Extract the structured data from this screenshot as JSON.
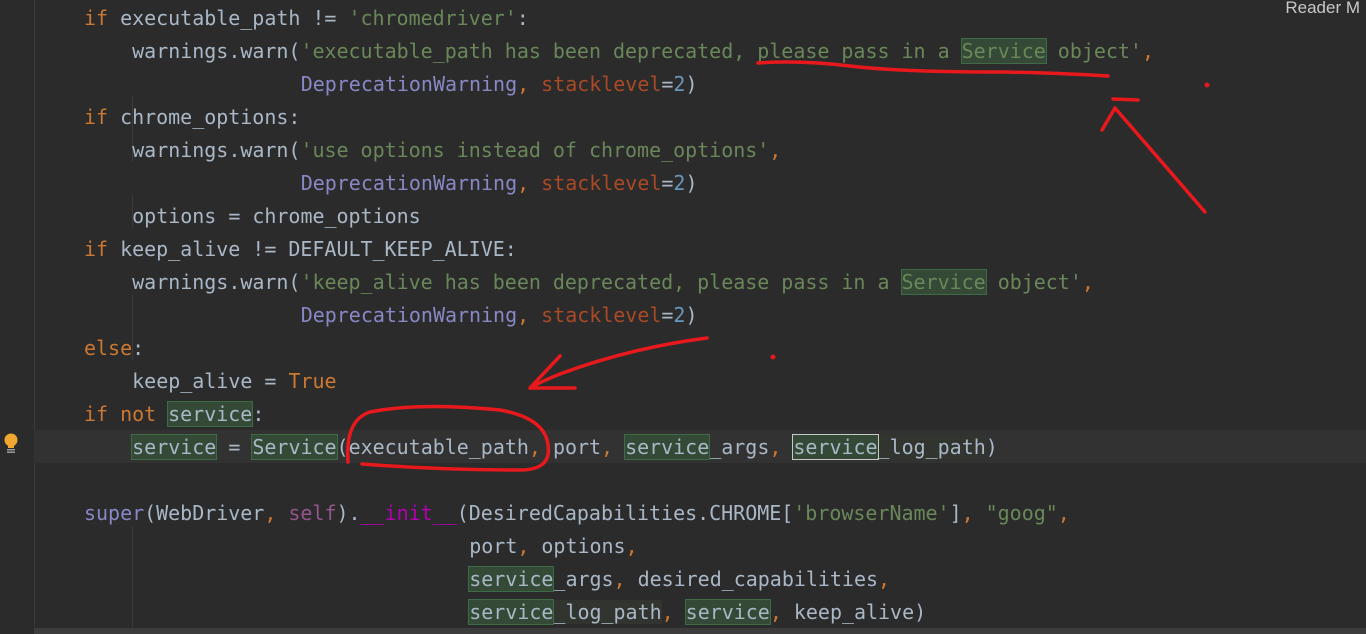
{
  "header": {
    "reader_mode_label": "Reader M"
  },
  "colors": {
    "background": "#2b2b2b",
    "keyword": "#cc7832",
    "string": "#6a8759",
    "builtin": "#8888c6",
    "param": "#aa4926",
    "number": "#6897bb",
    "annotation": "#e8191c"
  },
  "gutter": {
    "intention_icon": "lightbulb-icon"
  },
  "code": {
    "lines": [
      {
        "indent": 0,
        "tokens": [
          [
            "if",
            "kw"
          ],
          [
            " executable_path != ",
            ""
          ],
          [
            "'chromedriver'",
            "str"
          ],
          [
            ":",
            ""
          ]
        ]
      },
      {
        "indent": 4,
        "tokens": [
          [
            "warnings.warn(",
            ""
          ],
          [
            "'executable_path has been deprecated, please pass in a ",
            "str"
          ],
          [
            "Service",
            "str hl"
          ],
          [
            " object'",
            "str"
          ],
          [
            ",",
            "punc"
          ]
        ]
      },
      {
        "indent": 18,
        "tokens": [
          [
            "DeprecationWarning",
            "bi"
          ],
          [
            ", ",
            "punc"
          ],
          [
            "stacklevel",
            "param"
          ],
          [
            "=",
            ""
          ],
          [
            "2",
            "num"
          ],
          [
            ")",
            ""
          ]
        ]
      },
      {
        "indent": 0,
        "tokens": [
          [
            "if",
            "kw"
          ],
          [
            " chrome_options:",
            ""
          ]
        ]
      },
      {
        "indent": 4,
        "tokens": [
          [
            "warnings.warn(",
            ""
          ],
          [
            "'use options instead of chrome_options'",
            "str"
          ],
          [
            ",",
            "punc"
          ]
        ]
      },
      {
        "indent": 18,
        "tokens": [
          [
            "DeprecationWarning",
            "bi"
          ],
          [
            ", ",
            "punc"
          ],
          [
            "stacklevel",
            "param"
          ],
          [
            "=",
            ""
          ],
          [
            "2",
            "num"
          ],
          [
            ")",
            ""
          ]
        ]
      },
      {
        "indent": 4,
        "tokens": [
          [
            "options = chrome_options",
            ""
          ]
        ]
      },
      {
        "indent": 0,
        "tokens": [
          [
            "if",
            "kw"
          ],
          [
            " keep_alive != DEFAULT_KEEP_ALIVE:",
            ""
          ]
        ]
      },
      {
        "indent": 4,
        "tokens": [
          [
            "warnings.warn(",
            ""
          ],
          [
            "'keep_alive has been deprecated, please pass in a ",
            "str"
          ],
          [
            "Service",
            "str hl"
          ],
          [
            " object'",
            "str"
          ],
          [
            ",",
            "punc"
          ]
        ]
      },
      {
        "indent": 18,
        "tokens": [
          [
            "DeprecationWarning",
            "bi"
          ],
          [
            ", ",
            "punc"
          ],
          [
            "stacklevel",
            "param"
          ],
          [
            "=",
            ""
          ],
          [
            "2",
            "num"
          ],
          [
            ")",
            ""
          ]
        ]
      },
      {
        "indent": 0,
        "tokens": [
          [
            "else",
            "kw"
          ],
          [
            ":",
            ""
          ]
        ]
      },
      {
        "indent": 4,
        "tokens": [
          [
            "keep_alive = ",
            ""
          ],
          [
            "True",
            "kw"
          ]
        ]
      },
      {
        "indent": 0,
        "tokens": [
          [
            "if not ",
            "kw"
          ],
          [
            "service",
            "hl"
          ],
          [
            ":",
            ""
          ]
        ]
      },
      {
        "indent": 4,
        "tokens": [
          [
            "service",
            "hl"
          ],
          [
            " = ",
            ""
          ],
          [
            "Service",
            "hl"
          ],
          [
            "(executable_path",
            ""
          ],
          [
            ", ",
            "punc"
          ],
          [
            "port",
            ""
          ],
          [
            ", ",
            "punc"
          ],
          [
            "service",
            "hl"
          ],
          [
            "_args",
            ""
          ],
          [
            ", ",
            "punc"
          ],
          [
            "service",
            "hlbox"
          ],
          [
            "_log_path",
            "hl2"
          ],
          [
            ")",
            ""
          ]
        ]
      },
      {
        "indent": 0,
        "tokens": []
      },
      {
        "indent": 0,
        "tokens": [
          [
            "super",
            "bi"
          ],
          [
            "(WebDriver",
            ""
          ],
          [
            ", ",
            "punc"
          ],
          [
            "self",
            "self"
          ],
          [
            ").",
            ""
          ],
          [
            "__init__",
            "magic"
          ],
          [
            "(DesiredCapabilities.CHROME[",
            ""
          ],
          [
            "'browserName'",
            "str"
          ],
          [
            "]",
            ""
          ],
          [
            ", ",
            "punc"
          ],
          [
            "\"goog\"",
            "str"
          ],
          [
            ",",
            "punc"
          ]
        ]
      },
      {
        "indent": 32,
        "tokens": [
          [
            "port",
            ""
          ],
          [
            ", ",
            "punc"
          ],
          [
            "options",
            ""
          ],
          [
            ",",
            "punc"
          ]
        ]
      },
      {
        "indent": 32,
        "tokens": [
          [
            "service",
            "hl"
          ],
          [
            "_args",
            ""
          ],
          [
            ", ",
            "punc"
          ],
          [
            "desired_capabilities",
            ""
          ],
          [
            ",",
            "punc"
          ]
        ]
      },
      {
        "indent": 32,
        "tokens": [
          [
            "service",
            "hl"
          ],
          [
            "_log_path",
            "hl2"
          ],
          [
            ", ",
            "punc"
          ],
          [
            "service",
            "hl"
          ],
          [
            ", ",
            "punc"
          ],
          [
            "keep_alive)",
            ""
          ]
        ]
      }
    ]
  }
}
